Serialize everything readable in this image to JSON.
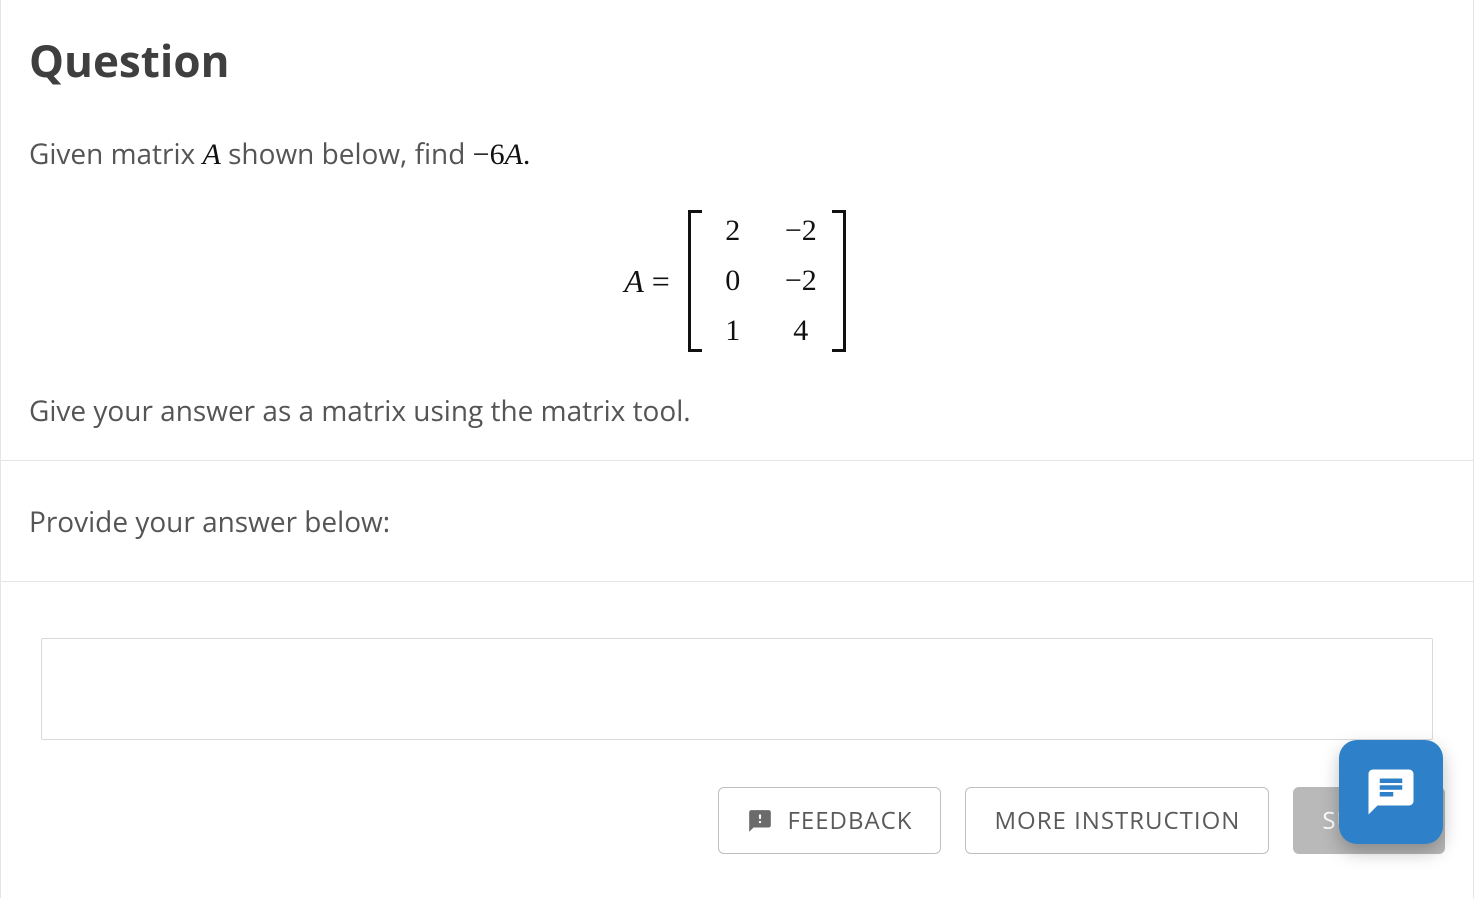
{
  "heading": "Question",
  "prompt": {
    "pre": "Given matrix ",
    "var1": "A",
    "mid": " shown below, find ",
    "expr_minus": "−",
    "expr_num": "6",
    "expr_var": "A",
    "suffix": "."
  },
  "matrix": {
    "label_var": "A",
    "label_eq": " = ",
    "cells": [
      "2",
      "−2",
      "0",
      "−2",
      "1",
      "4"
    ]
  },
  "hint": "Give your answer as a matrix using the matrix tool.",
  "provide": "Provide your answer below:",
  "buttons": {
    "feedback": "FEEDBACK",
    "more": "MORE INSTRUCTION",
    "submit": "SUBMIT"
  }
}
